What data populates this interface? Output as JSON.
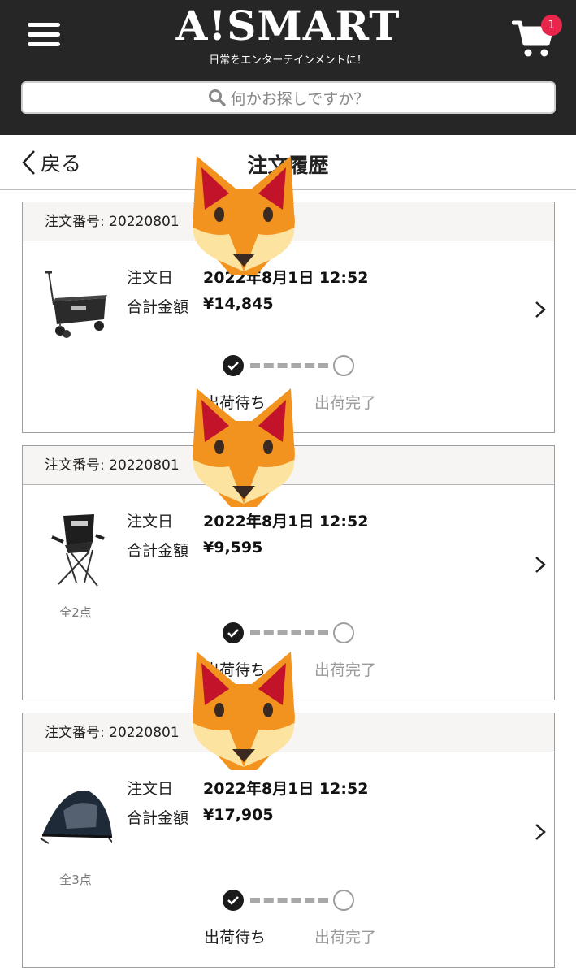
{
  "header": {
    "logo": "A!SMART",
    "tagline": "日常をエンターテインメントに！",
    "cart_count": "1",
    "search_placeholder": "何かお探しですか？",
    "icons": [
      "hamburger-menu-icon",
      "cart-icon",
      "search-icon"
    ]
  },
  "titlebar": {
    "back_label": "戻る",
    "title": "注文履歴"
  },
  "colors": {
    "header_bg": "#262626",
    "badge": "#e8264c",
    "card_head_bg": "#f7f5f4"
  },
  "orders": [
    {
      "order_number": "注文番号: 20220801",
      "date_label": "注文日",
      "date": "2022年8月1日 12:52",
      "total_label": "合計金額",
      "total": "¥14,845",
      "item_count": "",
      "product_icon": "folding-wagon",
      "status_steps": [
        "出荷待ち",
        "出荷完了"
      ]
    },
    {
      "order_number": "注文番号: 20220801",
      "date_label": "注文日",
      "date": "2022年8月1日 12:52",
      "total_label": "合計金額",
      "total": "¥9,595",
      "item_count": "全2点",
      "product_icon": "camping-chair",
      "status_steps": [
        "出荷待ち",
        "出荷完了"
      ]
    },
    {
      "order_number": "注文番号: 20220801",
      "date_label": "注文日",
      "date": "2022年8月1日 12:52",
      "total_label": "合計金額",
      "total": "¥17,905",
      "item_count": "全3点",
      "product_icon": "pop-up-tent",
      "status_steps": [
        "出荷待ち",
        "出荷完了"
      ]
    }
  ],
  "overlay_icons": [
    "fox-face-sticker",
    "fox-face-sticker",
    "fox-face-sticker"
  ]
}
